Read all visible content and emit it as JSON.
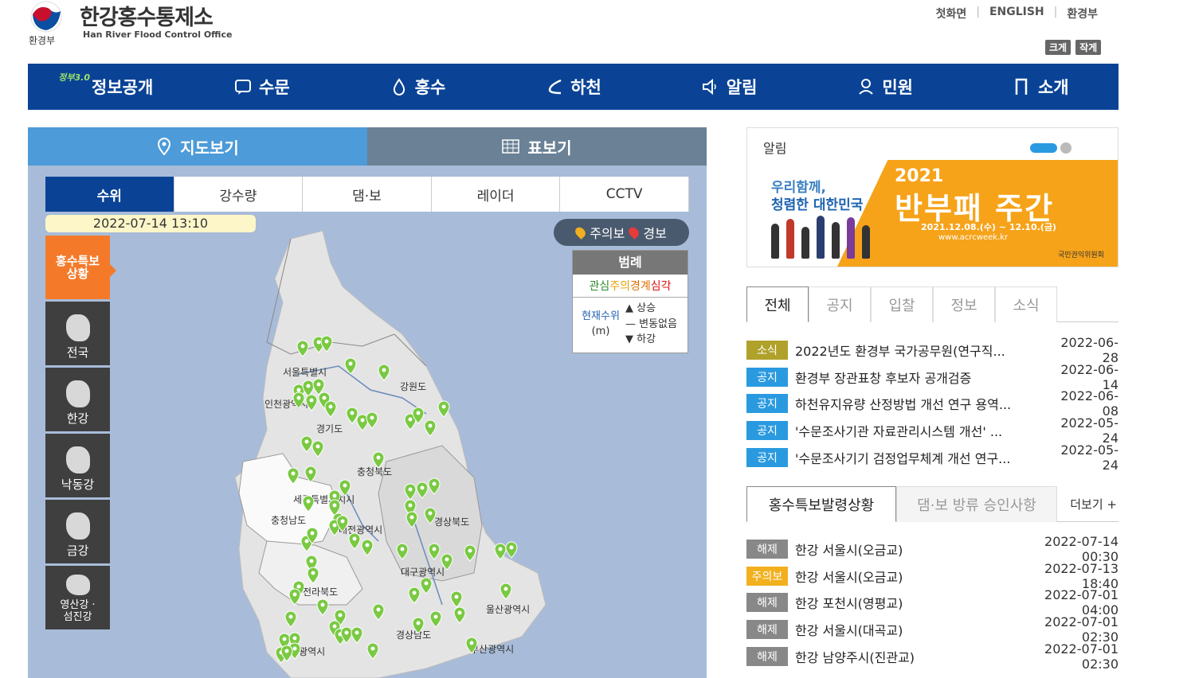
{
  "header": {
    "ministry": "환경부",
    "title_kr": "한강홍수통제소",
    "title_en": "Han River Flood Control Office",
    "util": [
      "첫화면",
      "ENGLISH",
      "환경부"
    ],
    "zoom_in": "크게",
    "zoom_out": "작게"
  },
  "nav": {
    "info_tag": "정부3.0",
    "items": [
      "정보공개",
      "수문",
      "홍수",
      "하천",
      "알림",
      "민원",
      "소개"
    ]
  },
  "map": {
    "view_tabs": [
      "지도보기",
      "표보기"
    ],
    "sub_tabs": [
      "수위",
      "강수량",
      "댐·보",
      "레이더",
      "CCTV"
    ],
    "datetime": "2022-07-14 13:10",
    "side_menu": [
      "홍수특보 상황",
      "전국",
      "한강",
      "낙동강",
      "금강",
      "영산강 · 섬진강"
    ],
    "alert_legend": {
      "watch": "주의보",
      "warning": "경보"
    },
    "legend": {
      "title": "범례",
      "levels": [
        "관심",
        "주의",
        "경계",
        "심각"
      ],
      "current": "현재수위",
      "unit": "(m)",
      "rise": "▲ 상승",
      "none": "— 변동없음",
      "fall": "▼ 하강"
    },
    "regions": [
      "서울특별시",
      "강원도",
      "인천광역시",
      "경기도",
      "충청북도",
      "세종특별자치시",
      "충청남도",
      "대전광역시",
      "경상북도",
      "대구광역시",
      "전라북도",
      "울산광역시",
      "경상남도",
      "광주광역시",
      "부산광역시"
    ],
    "colors": {
      "marker": "#7ac943",
      "watch": "#f2b01e",
      "warning": "#e63b3b"
    }
  },
  "notice_panel": {
    "title": "알림",
    "banner": {
      "slogan1": "우리함께,",
      "slogan2": "청렴한 대한민국",
      "year": "2021",
      "headline": "반부패 주간",
      "date": "2021.12.08.(수) ~ 12.10.(금)",
      "url": "www.acrcweek.kr",
      "org": "국민권익위원회"
    }
  },
  "board": {
    "tabs": [
      "전체",
      "공지",
      "입찰",
      "정보",
      "소식"
    ],
    "rows": [
      {
        "badge": "소식",
        "color": "#b0a12b",
        "title": "2022년도 환경부 국가공무원(연구직...",
        "date": "2022-06-28"
      },
      {
        "badge": "공지",
        "color": "#2a9ae0",
        "title": "환경부 장관표창 후보자 공개검증",
        "date": "2022-06-14"
      },
      {
        "badge": "공지",
        "color": "#2a9ae0",
        "title": "하천유지유량 산정방법 개선 연구 용역...",
        "date": "2022-06-08"
      },
      {
        "badge": "공지",
        "color": "#2a9ae0",
        "title": "'수문조사기관 자료관리시스템 개선' ...",
        "date": "2022-05-24"
      },
      {
        "badge": "공지",
        "color": "#2a9ae0",
        "title": "'수문조사기기 검정업무체계 개선 연구...",
        "date": "2022-05-24"
      }
    ]
  },
  "flood": {
    "tabs": [
      "홍수특보발령상황",
      "댐·보 방류 승인사항"
    ],
    "more": "더보기 +",
    "rows": [
      {
        "badge": "해제",
        "color": "#888888",
        "title": "한강 서울시(오금교)",
        "date": "2022-07-14 00:30"
      },
      {
        "badge": "주의보",
        "color": "#f2b01e",
        "title": "한강 서울시(오금교)",
        "date": "2022-07-13 18:40"
      },
      {
        "badge": "해제",
        "color": "#888888",
        "title": "한강 포천시(영평교)",
        "date": "2022-07-01 04:00"
      },
      {
        "badge": "해제",
        "color": "#888888",
        "title": "한강 서울시(대곡교)",
        "date": "2022-07-01 02:30"
      },
      {
        "badge": "해제",
        "color": "#888888",
        "title": "한강 남양주시(진관교)",
        "date": "2022-07-01 02:30"
      }
    ]
  }
}
